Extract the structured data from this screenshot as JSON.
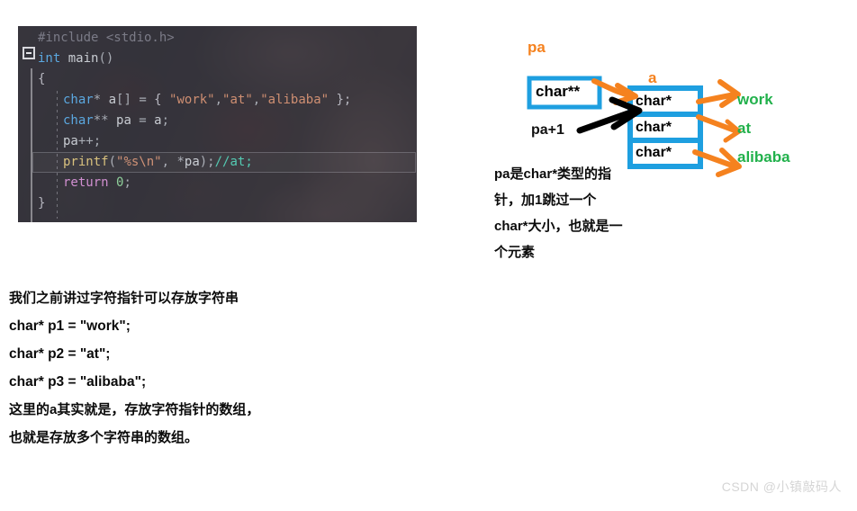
{
  "editor": {
    "name": "code-editor",
    "language": "c",
    "theme_background": "#303038",
    "current_line_number": 8,
    "fold_marker": "collapse",
    "lines": [
      {
        "id": "l1",
        "indent": 0,
        "tokens": [
          {
            "t": "#include ",
            "c": "t-pre"
          },
          {
            "t": "<stdio.h>",
            "c": "t-pre"
          }
        ]
      },
      {
        "id": "l2",
        "indent": 0,
        "tokens": [
          {
            "t": "int",
            "c": "t-kw"
          },
          {
            "t": " ",
            "c": "t-id"
          },
          {
            "t": "main",
            "c": "t-id"
          },
          {
            "t": "()",
            "c": "t-op"
          }
        ]
      },
      {
        "id": "l3",
        "indent": 0,
        "tokens": [
          {
            "t": "{",
            "c": "t-brc"
          }
        ]
      },
      {
        "id": "l4",
        "indent": 1,
        "tokens": [
          {
            "t": "char",
            "c": "t-type"
          },
          {
            "t": "* ",
            "c": "t-op"
          },
          {
            "t": "a",
            "c": "t-id"
          },
          {
            "t": "[] ",
            "c": "t-op"
          },
          {
            "t": "= ",
            "c": "t-op"
          },
          {
            "t": "{ ",
            "c": "t-brc"
          },
          {
            "t": "\"work\"",
            "c": "t-str"
          },
          {
            "t": ",",
            "c": "t-op"
          },
          {
            "t": "\"at\"",
            "c": "t-str"
          },
          {
            "t": ",",
            "c": "t-op"
          },
          {
            "t": "\"alibaba\"",
            "c": "t-str"
          },
          {
            "t": " };",
            "c": "t-brc"
          }
        ]
      },
      {
        "id": "l5",
        "indent": 1,
        "tokens": [
          {
            "t": "char",
            "c": "t-type"
          },
          {
            "t": "** ",
            "c": "t-op"
          },
          {
            "t": "pa",
            "c": "t-id"
          },
          {
            "t": " = ",
            "c": "t-op"
          },
          {
            "t": "a",
            "c": "t-id"
          },
          {
            "t": ";",
            "c": "t-op"
          }
        ]
      },
      {
        "id": "l6",
        "indent": 1,
        "tokens": [
          {
            "t": "pa",
            "c": "t-id"
          },
          {
            "t": "++;",
            "c": "t-op"
          }
        ]
      },
      {
        "id": "l7",
        "indent": 1,
        "current": true,
        "tokens": [
          {
            "t": "printf",
            "c": "t-fn"
          },
          {
            "t": "(",
            "c": "t-op"
          },
          {
            "t": "\"%s\\n\"",
            "c": "t-str"
          },
          {
            "t": ", ",
            "c": "t-op"
          },
          {
            "t": "*",
            "c": "t-op"
          },
          {
            "t": "pa",
            "c": "t-id"
          },
          {
            "t": ");",
            "c": "t-op"
          },
          {
            "t": "//at;",
            "c": "t-cmt"
          }
        ]
      },
      {
        "id": "l8",
        "indent": 1,
        "tokens": [
          {
            "t": "return",
            "c": "t-ret"
          },
          {
            "t": " ",
            "c": "t-id"
          },
          {
            "t": "0",
            "c": "t-num"
          },
          {
            "t": ";",
            "c": "t-op"
          }
        ]
      },
      {
        "id": "l9",
        "indent": 0,
        "tokens": [
          {
            "t": "}",
            "c": "t-brc"
          }
        ]
      }
    ]
  },
  "diagram": {
    "colors": {
      "box_border": "#1e9fe0",
      "pointer_arrow": "#f5821f",
      "plus_one_arrow": "#000000",
      "string_text": "#22b14c",
      "variable_label": "#f5821f"
    },
    "pa_label": "pa",
    "a_label": "a",
    "pa_plus_one_label": "pa+1",
    "pointer_box_text": "char**",
    "array_cells": [
      {
        "text": "char*",
        "points_to": "work"
      },
      {
        "text": "char*",
        "points_to": "at"
      },
      {
        "text": "char*",
        "points_to": "alibaba"
      }
    ],
    "strings": [
      "work",
      "at",
      "alibaba"
    ]
  },
  "note_right": {
    "lines": [
      "pa是char*类型的指",
      "针，加1跳过一个",
      "char*大小，也就是一",
      "个元素"
    ]
  },
  "note_left": {
    "lines": [
      {
        "text": "我们之前讲过字符指针可以存放字符串",
        "code": false
      },
      {
        "text": "char* p1 = \"work\";",
        "code": true
      },
      {
        "text": "char* p2 = \"at\";",
        "code": true
      },
      {
        "text": "char* p3 = \"alibaba\";",
        "code": true
      },
      {
        "text": "这里的a其实就是，存放字符指针的数组，",
        "code": false
      },
      {
        "text": "也就是存放多个字符串的数组。",
        "code": false
      }
    ]
  },
  "watermark": {
    "text": "CSDN @小镇敲码人"
  }
}
